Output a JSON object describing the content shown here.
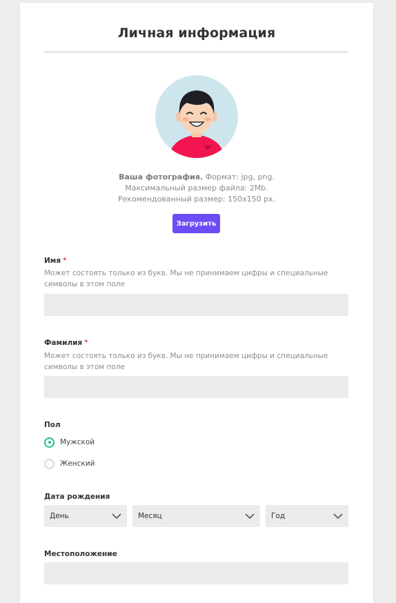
{
  "page": {
    "title": "Личная информация"
  },
  "photo": {
    "label_bold": "Ваша фотография.",
    "format": "Формат: jpg, png.",
    "max_size": "Максимальный размер файла: 2Mb.",
    "recommended": "Рекомендованный размер: 150x150 px.",
    "upload_label": "Загрузить"
  },
  "first_name": {
    "label": "Имя",
    "required_mark": "*",
    "hint": "Может состоять только из букв. Мы не принимаем цифры и специальные символы в этом поле",
    "value": ""
  },
  "last_name": {
    "label": "Фамилия",
    "required_mark": "*",
    "hint": "Может состоять только из букв. Мы не принимаем цифры и специальные символы в этом поле",
    "value": ""
  },
  "gender": {
    "label": "Пол",
    "options": [
      {
        "label": "Мужской",
        "selected": true
      },
      {
        "label": "Женский",
        "selected": false
      }
    ]
  },
  "birth_date": {
    "label": "Дата рождения",
    "day": "День",
    "month": "Месяц",
    "year": "Год"
  },
  "location": {
    "label": "Местоположение",
    "value": ""
  },
  "colors": {
    "accent": "#6e4cf5",
    "radio_selected": "#1fc18a",
    "required": "#e03a3a",
    "input_bg": "#ebebeb"
  },
  "icons": {
    "avatar": "avatar-illustration",
    "dropdown": "chevron-down-icon"
  }
}
